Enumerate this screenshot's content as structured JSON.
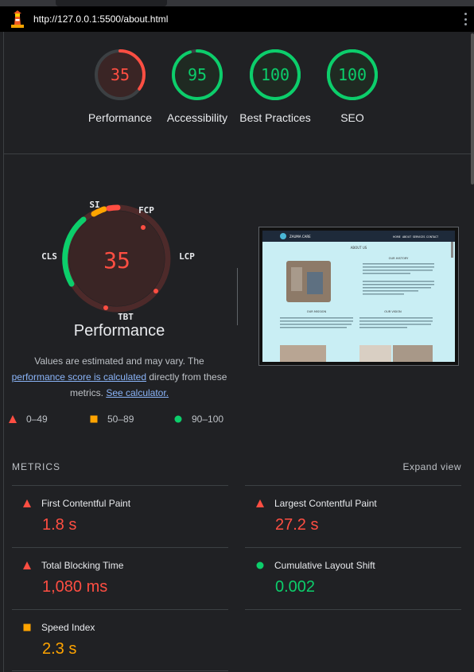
{
  "browser": {
    "url": "http://127.0.0.1:5500/about.html"
  },
  "colors": {
    "fail": "#ff4e42",
    "average": "#ffa400",
    "pass": "#0cce6b",
    "background": "#202124"
  },
  "scores": [
    {
      "label": "Performance",
      "value": "35",
      "fraction": 0.35,
      "rating": "fail"
    },
    {
      "label": "Accessibility",
      "value": "95",
      "fraction": 0.95,
      "rating": "pass"
    },
    {
      "label": "Best Practices",
      "value": "100",
      "fraction": 1.0,
      "rating": "pass"
    },
    {
      "label": "SEO",
      "value": "100",
      "fraction": 1.0,
      "rating": "pass"
    }
  ],
  "performance": {
    "score": "35",
    "title": "Performance",
    "segments": [
      "SI",
      "FCP",
      "LCP",
      "TBT",
      "CLS"
    ],
    "desc_prefix": "Values are estimated and may vary. The",
    "desc_link1": "performance score is calculated",
    "desc_mid": "directly from these metrics.",
    "desc_link2": "See calculator."
  },
  "legend": [
    {
      "icon": "triangle-icon",
      "label": "0–49"
    },
    {
      "icon": "square-icon",
      "label": "50–89"
    },
    {
      "icon": "circle-icon",
      "label": "90–100"
    }
  ],
  "metrics": {
    "heading": "METRICS",
    "expand": "Expand view",
    "items": [
      {
        "title": "First Contentful Paint",
        "value": "1.8 s",
        "rating": "fail"
      },
      {
        "title": "Largest Contentful Paint",
        "value": "27.2 s",
        "rating": "fail"
      },
      {
        "title": "Total Blocking Time",
        "value": "1,080 ms",
        "rating": "fail"
      },
      {
        "title": "Cumulative Layout Shift",
        "value": "0.002",
        "rating": "pass"
      },
      {
        "title": "Speed Index",
        "value": "2.3 s",
        "rating": "average"
      }
    ]
  },
  "thumbnail": {
    "site_name": "ZAUMA CARE",
    "nav": [
      "HOME",
      "ABOUT",
      "SERVICES",
      "CONTACT"
    ],
    "heading": "ABOUT US",
    "story_heading": "OUR HISTORY",
    "mission_heading": "OUR MISSION",
    "vision_heading": "OUR VISION"
  }
}
